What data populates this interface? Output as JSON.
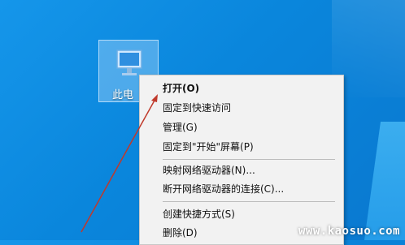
{
  "desktop": {
    "icon_label": "此电",
    "icon_name": "monitor-icon"
  },
  "context_menu": {
    "items": [
      {
        "label": "打开(O)",
        "bold": true
      },
      {
        "label": "固定到快速访问"
      },
      {
        "label": "管理(G)"
      },
      {
        "label": "固定到\"开始\"屏幕(P)"
      },
      {
        "label": "映射网络驱动器(N)..."
      },
      {
        "label": "断开网络驱动器的连接(C)..."
      },
      {
        "label": "创建快捷方式(S)"
      },
      {
        "label": "删除(D)"
      }
    ]
  },
  "annotation": {
    "arrow_color": "#c0392b"
  },
  "watermark": "www.kaosuo.com"
}
